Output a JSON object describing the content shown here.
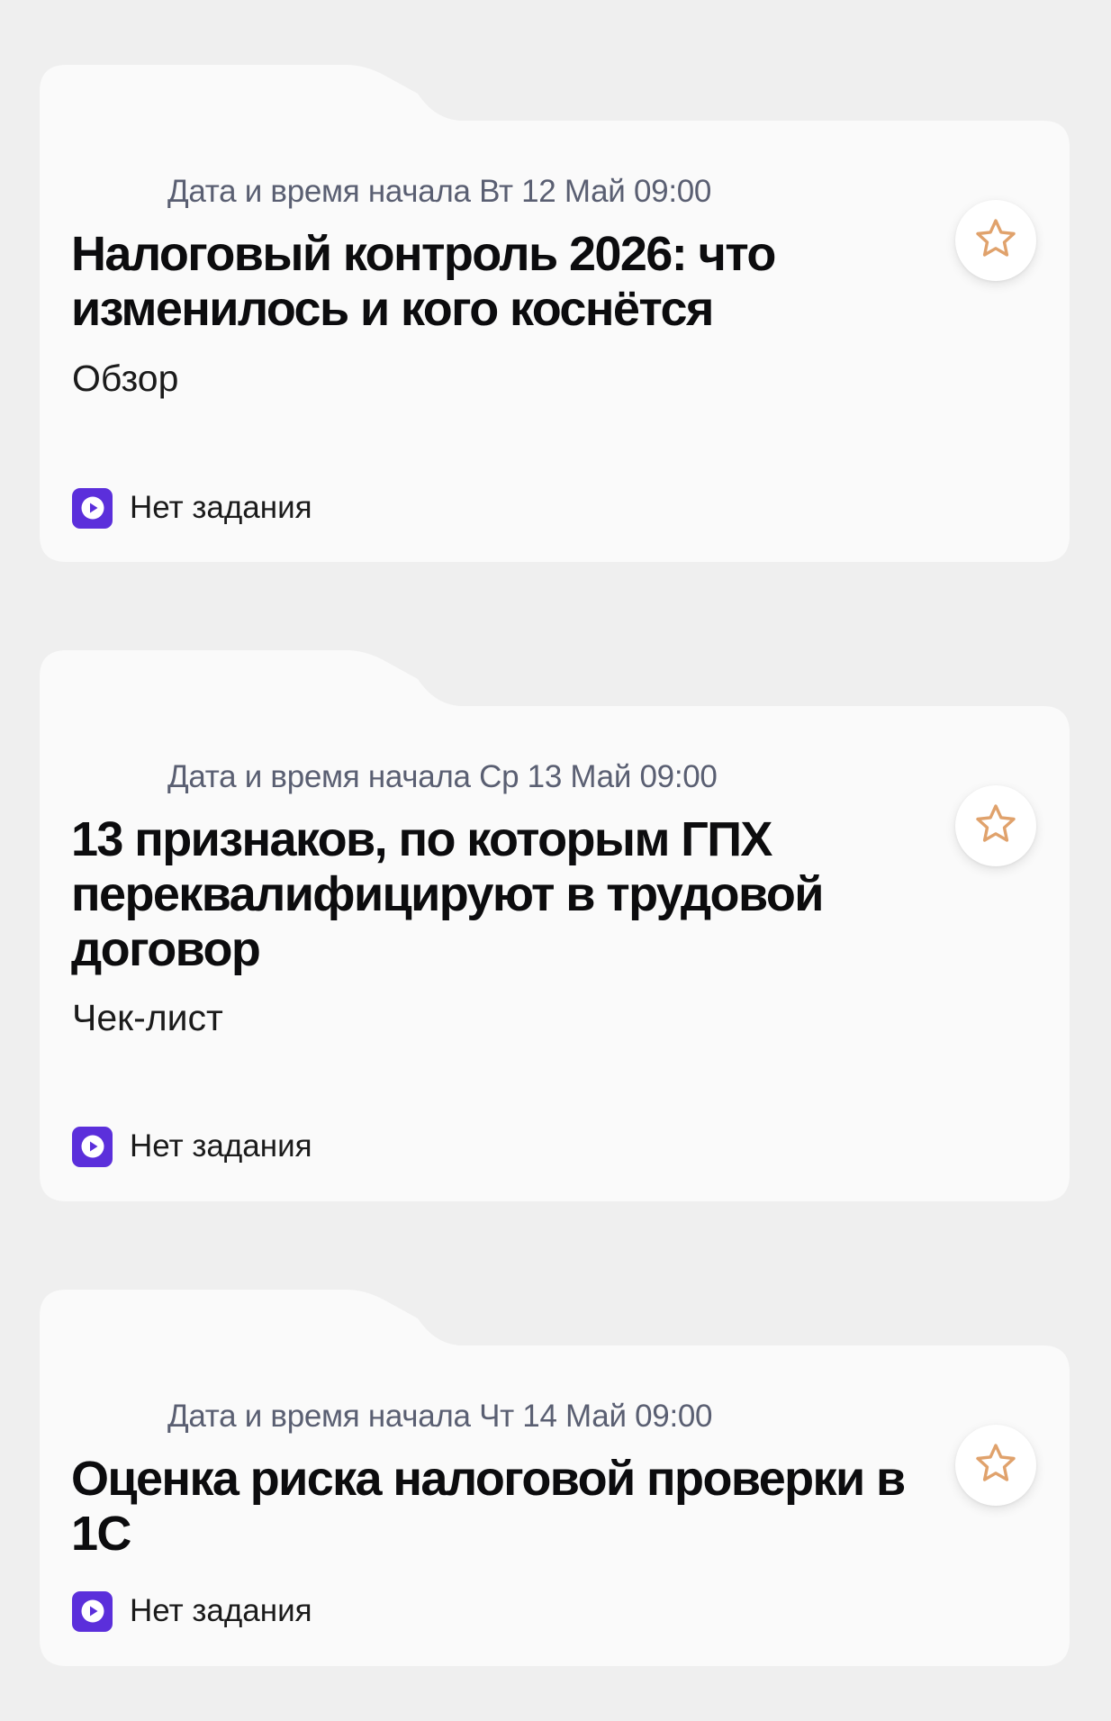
{
  "colors": {
    "background": "#efefef",
    "card": "#fafafa",
    "accent": "#5b2fdb",
    "star": "#e0a26c",
    "date_text": "#5a5f72"
  },
  "events": [
    {
      "date_label": "Дата и время начала Вт 12 Май 09:00",
      "title": "Налоговый контроль 2026: что изменилось и кого коснётся",
      "type": "Обзор",
      "task_status": "Нет задания",
      "task_icon": "play-icon",
      "favorite_icon": "star-outline-icon"
    },
    {
      "date_label": "Дата и время начала Ср 13 Май 09:00",
      "title": "13 признаков, по которым ГПХ переквалифицируют в трудовой договор",
      "type": "Чек-лист",
      "task_status": "Нет задания",
      "task_icon": "play-icon",
      "favorite_icon": "star-outline-icon"
    },
    {
      "date_label": "Дата и время начала Чт 14 Май 09:00",
      "title": "Оценка риска налоговой проверки в 1С",
      "task_status": "Нет задания",
      "task_icon": "play-icon",
      "favorite_icon": "star-outline-icon"
    }
  ]
}
